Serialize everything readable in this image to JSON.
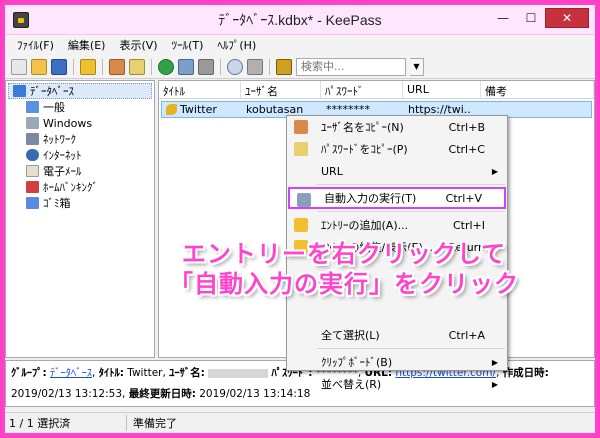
{
  "window": {
    "title": "ﾃﾞｰﾀﾍﾞｰｽ.kdbx* - KeePass",
    "minimize": "—",
    "maximize": "☐",
    "close": "✕"
  },
  "menu": [
    "ﾌｧｲﾙ(F)",
    "編集(E)",
    "表示(V)",
    "ﾂｰﾙ(T)",
    "ﾍﾙﾌﾟ(H)"
  ],
  "toolbar": {
    "search_placeholder": "検索中..."
  },
  "tree": {
    "root": "ﾃﾞｰﾀﾍﾞｰｽ",
    "items": [
      "一般",
      "Windows",
      "ﾈｯﾄﾜｰｸ",
      "ｲﾝﾀｰﾈｯﾄ",
      "電子ﾒｰﾙ",
      "ﾎｰﾑﾊﾞﾝｷﾝｸﾞ",
      "ｺﾞﾐ箱"
    ]
  },
  "list": {
    "headers": [
      "ﾀｲﾄﾙ",
      "ﾕｰｻﾞ名",
      "ﾊﾟｽﾜｰﾄﾞ",
      "URL",
      "備考"
    ],
    "rows": [
      {
        "title": "Twitter",
        "user": "kobutasan",
        "password": "********",
        "url": "https://twi..",
        "notes": ""
      }
    ]
  },
  "context_menu": [
    {
      "label": "ﾕｰｻﾞ名をｺﾋﾟｰ(N)",
      "shortcut": "Ctrl+B",
      "icon": "user-icon"
    },
    {
      "label": "ﾊﾟｽﾜｰﾄﾞをｺﾋﾟｰ(P)",
      "shortcut": "Ctrl+C",
      "icon": "key-icon"
    },
    {
      "label": "URL",
      "shortcut": "",
      "submenu": true
    },
    {
      "sep": true
    },
    {
      "label": "自動入力の実行(T)",
      "shortcut": "Ctrl+V",
      "icon": "keyboard-icon",
      "highlight": true
    },
    {
      "sep": true
    },
    {
      "label": "ｴﾝﾄﾘｰの追加(A)...",
      "shortcut": "Ctrl+I",
      "icon": "add-entry-icon"
    },
    {
      "label": "ｴﾝﾄﾘｰの編集/表示(E)...",
      "shortcut": "Return",
      "icon": "edit-entry-icon"
    },
    {
      "label": "",
      "shortcut": "",
      "faded": true
    },
    {
      "label": "",
      "shortcut": "",
      "faded": true
    },
    {
      "label": "",
      "shortcut": "",
      "faded": true
    },
    {
      "label": "全て選択(L)",
      "shortcut": "Ctrl+A"
    },
    {
      "sep": true
    },
    {
      "label": "ｸﾘｯﾌﾟﾎﾞｰﾄﾞ(B)",
      "shortcut": "",
      "submenu": true
    },
    {
      "label": "並べ替え(R)",
      "shortcut": "",
      "submenu": true
    }
  ],
  "details": {
    "group_label": "ｸﾞﾙｰﾌﾟ:",
    "group_value": "ﾃﾞｰﾀﾍﾞｰｽ",
    "title_label": "ﾀｲﾄﾙ:",
    "title_value": "Twitter,",
    "user_label": "ﾕｰｻﾞ名:",
    "password_label": "ﾊﾟｽﾜｰﾄﾞ:",
    "password_value": "********,",
    "url_label": "URL:",
    "url_value": "https://twitter.com/",
    "created_label": "作成日時:",
    "created_value": "2019/02/13 13:12:53,",
    "modified_label": "最終更新日時:",
    "modified_value": "2019/02/13 13:14:18"
  },
  "status": {
    "selection": "1 / 1 選択済",
    "state": "準備完了"
  },
  "overlay": {
    "line1": "エントリーを右クリックして",
    "line2": "「自動入力の実行」をクリック"
  },
  "colors": {
    "accent": "#ff44cc",
    "highlight_border": "#cc44ff",
    "selection": "#cde8ff"
  }
}
